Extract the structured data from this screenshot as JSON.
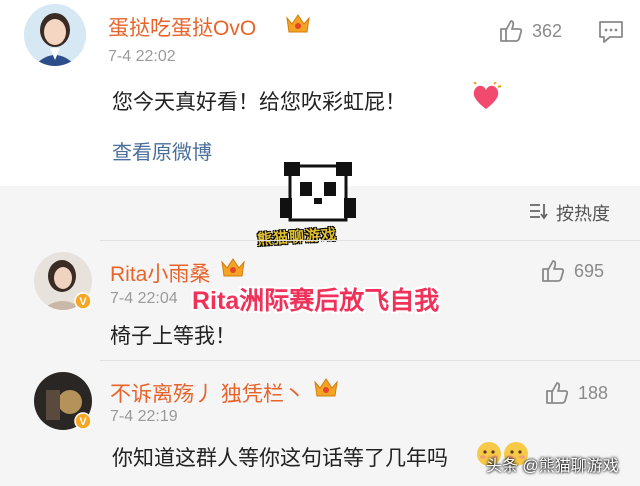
{
  "comments": [
    {
      "username": "蛋挞吃蛋挞OvO",
      "time": "7-4 22:02",
      "text": "您今天真好看！给您吹彩虹屁！",
      "likes": "362"
    },
    {
      "username": "Rita小雨桑",
      "time": "7-4 22:04",
      "text": "椅子上等我！",
      "likes": "695"
    },
    {
      "username": "不诉离殇丿 独凭栏丶",
      "time": "7-4 22:19",
      "text": "你知道这群人等你这句话等了几年吗",
      "likes": "188"
    }
  ],
  "view_original": "查看原微博",
  "sort_label": "按热度",
  "watermark": {
    "caption": "熊猫聊游戏",
    "overlay": "Rita洲际赛后放飞自我",
    "footer": "头条 @熊猫聊游戏"
  },
  "colors": {
    "username": "#e8632a",
    "link": "#4a6f9a",
    "overlay": "#f0325a"
  },
  "icons": [
    "thumbs-up-icon",
    "message-icon",
    "crown-badge-icon",
    "sort-icon",
    "verified-badge-icon",
    "heart-emoji-icon",
    "shy-emoji-icon"
  ]
}
